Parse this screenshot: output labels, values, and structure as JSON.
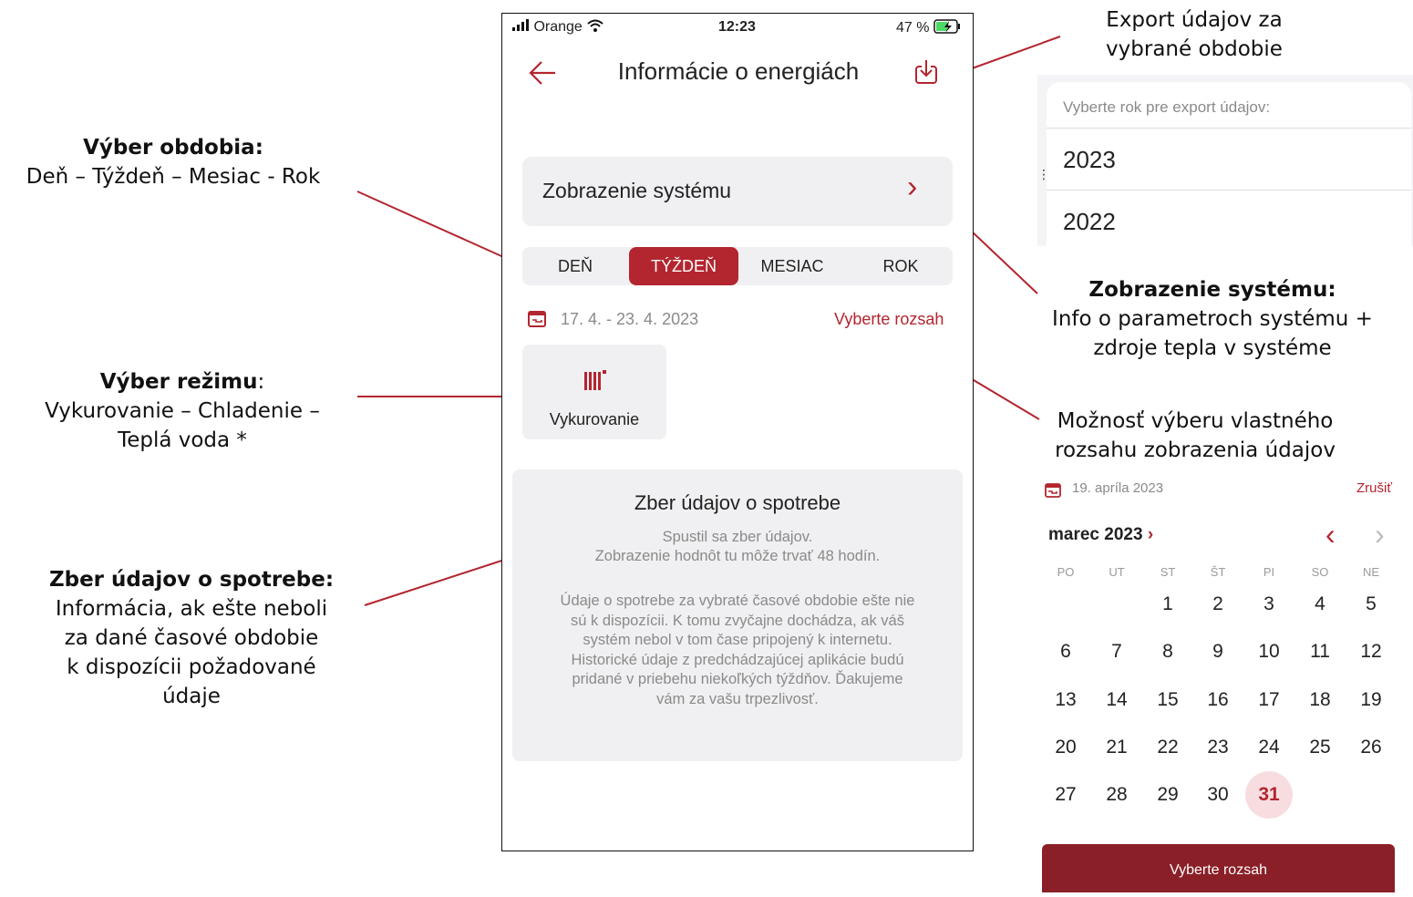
{
  "annotations": {
    "period": {
      "title": "Výber obdobia:",
      "lines": [
        "Deň – Týždeň – Mesiac - Rok"
      ]
    },
    "mode": {
      "title": "Výber režimu",
      "colon": ":",
      "lines": [
        "Vykurovanie – Chladenie –",
        "Teplá voda *"
      ]
    },
    "consumption": {
      "title": "Zber údajov o spotrebe:",
      "lines": [
        "Informácia, ak ešte neboli",
        "za dané časové obdobie",
        "k dispozícii požadované",
        "údaje"
      ]
    },
    "export": {
      "lines": [
        "Export údajov za",
        "vybrané obdobie"
      ]
    },
    "system": {
      "title": "Zobrazenie systému:",
      "lines": [
        "Info o parametroch systému +",
        "zdroje tepla v systéme"
      ]
    },
    "range": {
      "lines": [
        "Možnosť výberu vlastného",
        "rozsahu zobrazenia údajov"
      ]
    }
  },
  "phone": {
    "status": {
      "carrier": "Orange",
      "time": "12:23",
      "battery": "47 %"
    },
    "header": {
      "title": "Informácie o energiách",
      "back_icon": "arrow-left-icon",
      "export_icon": "download-icon"
    },
    "system_view": {
      "label": "Zobrazenie systému",
      "chevron": "›"
    },
    "periods": [
      {
        "label": "DEŇ",
        "active": false
      },
      {
        "label": "TÝŽDEŇ",
        "active": true
      },
      {
        "label": "MESIAC",
        "active": false
      },
      {
        "label": "ROK",
        "active": false
      }
    ],
    "date_range": {
      "text": "17. 4. - 23. 4. 2023",
      "action": "Vyberte rozsah"
    },
    "mode": {
      "label": "Vykurovanie",
      "icon": "radiator-icon"
    },
    "info_card": {
      "title": "Zber údajov o spotrebe",
      "subtitle_lines": [
        "Spustil sa zber údajov.",
        "Zobrazenie hodnôt tu môže trvať 48 hodín."
      ],
      "body_lines": [
        "Údaje o spotrebe za vybraté časové obdobie ešte nie",
        "sú k dispozícii. K tomu zvyčajne dochádza, ak váš",
        "systém nebol v tom čase pripojený k internetu.",
        "Historické údaje z predchádzajúcej aplikácie budú",
        "pridané v priebehu niekoľkých týždňov. Ďakujeme",
        "vám za vašu trpezlivosť."
      ]
    }
  },
  "export_panel": {
    "prompt": "Vyberte rok pre export údajov:",
    "years": [
      "2023",
      "2022"
    ]
  },
  "calendar": {
    "selected_date": "19. apríla 2023",
    "cancel": "Zrušiť",
    "month": "marec 2023",
    "month_arrow": "›",
    "prev": "‹",
    "next": "›",
    "weekdays": [
      "PO",
      "UT",
      "ST",
      "ŠT",
      "PI",
      "SO",
      "NE"
    ],
    "weeks": [
      [
        "",
        "",
        "1",
        "2",
        "3",
        "4",
        "5"
      ],
      [
        "6",
        "7",
        "8",
        "9",
        "10",
        "11",
        "12"
      ],
      [
        "13",
        "14",
        "15",
        "16",
        "17",
        "18",
        "19"
      ],
      [
        "20",
        "21",
        "22",
        "23",
        "24",
        "25",
        "26"
      ],
      [
        "27",
        "28",
        "29",
        "30",
        "31",
        "",
        ""
      ]
    ],
    "highlighted_day": "31",
    "button": "Vyberte rozsah"
  },
  "colors": {
    "accent": "#b3252f",
    "card": "#f0f0f2",
    "highlight": "#f7dde0"
  }
}
